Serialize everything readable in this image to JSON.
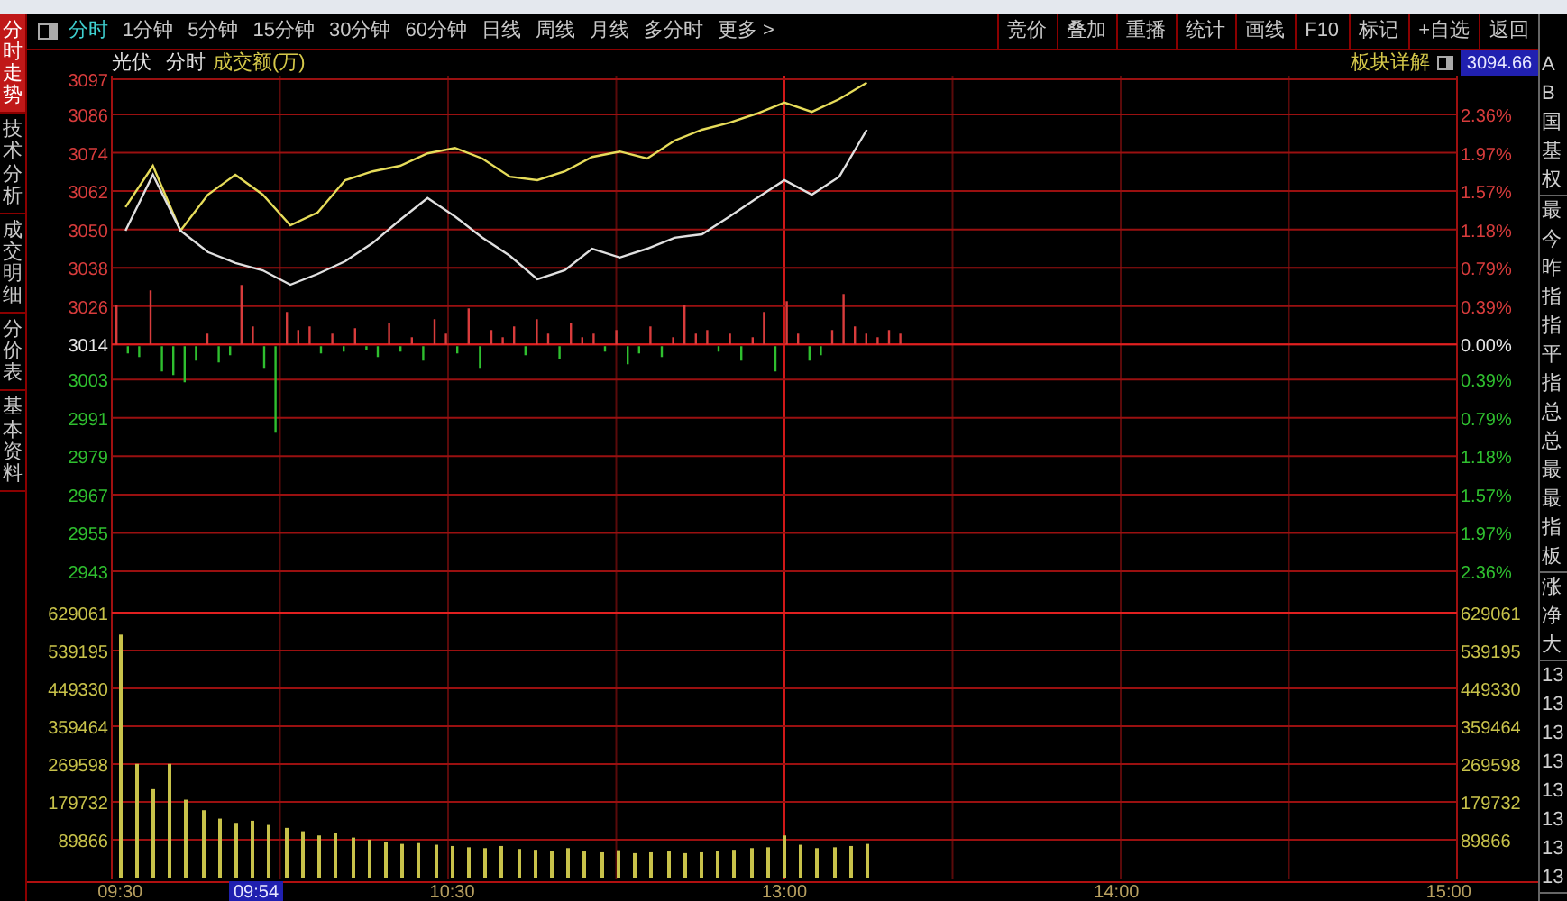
{
  "left_tabs": [
    {
      "label": "分时走势",
      "selected": true
    },
    {
      "label": "技术分析",
      "selected": false
    },
    {
      "label": "成交明细",
      "selected": false
    },
    {
      "label": "分价表",
      "selected": false
    },
    {
      "label": "基本资料",
      "selected": false
    }
  ],
  "period_tabs": [
    {
      "label": "分时",
      "selected": true
    },
    {
      "label": "1分钟",
      "selected": false
    },
    {
      "label": "5分钟",
      "selected": false
    },
    {
      "label": "15分钟",
      "selected": false
    },
    {
      "label": "30分钟",
      "selected": false
    },
    {
      "label": "60分钟",
      "selected": false
    },
    {
      "label": "日线",
      "selected": false
    },
    {
      "label": "周线",
      "selected": false
    },
    {
      "label": "月线",
      "selected": false
    },
    {
      "label": "多分时",
      "selected": false
    },
    {
      "label": "更多 >",
      "selected": false
    }
  ],
  "toolbar_buttons": [
    "竞价",
    "叠加",
    "重播",
    "统计",
    "画线",
    "F10",
    "标记",
    "+自选",
    "返回"
  ],
  "header": {
    "name": "光伏",
    "mode": "分时",
    "indicator": "成交额(万)",
    "detail_link": "板块详解"
  },
  "cursor": {
    "price": "3094.66",
    "time": "09:54"
  },
  "price_pane": {
    "chart_data": {
      "type": "line",
      "grid": true,
      "categories": [
        null,
        null,
        null,
        null,
        null,
        null,
        null,
        null,
        null,
        null,
        null,
        null,
        null,
        null,
        null,
        null,
        null,
        null,
        null,
        null,
        null,
        null,
        null,
        null,
        null,
        null,
        null,
        null,
        null,
        null,
        null,
        null,
        null,
        null,
        null,
        null,
        null,
        null,
        null,
        null,
        null,
        null,
        null,
        null,
        null,
        null,
        null,
        null,
        null
      ],
      "series": [
        {
          "color": "#e6dc5a",
          "values": [
            3057.0,
            3069.9,
            3049.6,
            3060.9,
            3067.1,
            3060.9,
            3051.3,
            3055.3,
            3065.4,
            3068.2,
            3069.9,
            3073.8,
            3075.5,
            3072.2,
            3066.5,
            3065.4,
            3068.2,
            3072.7,
            3074.4,
            3072.2,
            3077.8,
            3081.2,
            3083.4,
            3086.3,
            3089.7,
            3086.8,
            3090.8,
            3095.9,
            null,
            null,
            null,
            null,
            null,
            null,
            null,
            null,
            null,
            null,
            null,
            null,
            null,
            null,
            null,
            null,
            null,
            null,
            null,
            null,
            null
          ]
        },
        {
          "color": "#e0e0e0",
          "values": [
            3049.6,
            3067.1,
            3049.6,
            3042.9,
            3039.5,
            3037.2,
            3032.7,
            3036.1,
            3040.0,
            3045.7,
            3053.0,
            3059.8,
            3054.1,
            3047.4,
            3041.7,
            3034.4,
            3037.2,
            3044.0,
            3041.2,
            3044.0,
            3047.4,
            3048.5,
            3054.1,
            3059.8,
            3065.4,
            3060.9,
            3066.5,
            3081.2,
            null,
            null,
            null,
            null,
            null,
            null,
            null,
            null,
            null,
            null,
            null,
            null,
            null,
            null,
            null,
            null,
            null,
            null,
            null,
            null,
            null
          ]
        }
      ],
      "ylim": [
        2943,
        3097
      ],
      "yticks": [
        3097,
        3086,
        3074,
        3062,
        3050,
        3038,
        3026,
        3014,
        3003,
        2991,
        2979,
        2967,
        2955,
        2943
      ]
    },
    "percent_labels": [
      {
        "label": "2.36%",
        "kind": "up"
      },
      {
        "label": "1.97%",
        "kind": "up"
      },
      {
        "label": "1.57%",
        "kind": "up"
      },
      {
        "label": "1.18%",
        "kind": "up"
      },
      {
        "label": "0.79%",
        "kind": "up"
      },
      {
        "label": "0.39%",
        "kind": "up"
      },
      {
        "label": "0.00%",
        "kind": "flat"
      },
      {
        "label": "0.39%",
        "kind": "down"
      },
      {
        "label": "0.79%",
        "kind": "down"
      },
      {
        "label": "1.18%",
        "kind": "down"
      },
      {
        "label": "1.57%",
        "kind": "down"
      },
      {
        "label": "1.97%",
        "kind": "down"
      },
      {
        "label": "2.36%",
        "kind": "down"
      }
    ]
  },
  "volume_pane": {
    "chart_data": {
      "type": "bar",
      "grid": true,
      "categories": [
        "09:30",
        null,
        null,
        null,
        null,
        null,
        null,
        null,
        null,
        null,
        null,
        null,
        null,
        null,
        null,
        null,
        null,
        null,
        null,
        null,
        "10:30",
        null,
        null,
        null,
        null,
        null,
        null,
        null,
        null,
        null,
        null,
        null,
        null,
        null,
        null,
        null,
        null,
        null,
        null,
        null,
        "13:00",
        null,
        null,
        null,
        null,
        null,
        null,
        null,
        null,
        null,
        null,
        null,
        null,
        null,
        null,
        null,
        null,
        null,
        null,
        null,
        "14:00",
        null,
        null,
        null,
        null,
        null,
        null,
        null,
        null,
        null,
        null,
        null,
        null,
        null,
        null,
        null,
        null,
        null,
        null,
        null,
        "15:00"
      ],
      "values": [
        577000,
        270000,
        210000,
        270000,
        185000,
        160000,
        140000,
        130000,
        135000,
        125000,
        118000,
        110000,
        100000,
        105000,
        95000,
        90000,
        85000,
        80000,
        82000,
        78000,
        75000,
        72000,
        70000,
        75000,
        68000,
        66000,
        64000,
        70000,
        62000,
        60000,
        65000,
        58000,
        60000,
        62000,
        58000,
        60000,
        64000,
        66000,
        70000,
        72000,
        100000,
        78000,
        70000,
        72000,
        75000,
        80000,
        null,
        null,
        null,
        null,
        null,
        null,
        null,
        null,
        null,
        null,
        null,
        null,
        null,
        null,
        null,
        null,
        null,
        null,
        null,
        null,
        null,
        null,
        null,
        null,
        null,
        null,
        null,
        null,
        null,
        null,
        null,
        null,
        null,
        null,
        null
      ],
      "ylim": [
        0,
        629061
      ],
      "yticks": [
        629061,
        539195,
        449330,
        359464,
        269598,
        179732,
        89866
      ]
    },
    "right_labels": [
      "629061",
      "539195",
      "449330",
      "359464",
      "269598",
      "179732",
      "89866"
    ]
  },
  "side_panel": [
    [
      "A",
      "B",
      "国",
      "基",
      "权"
    ],
    [
      "最",
      "今",
      "昨",
      "指",
      "指",
      "平",
      "指",
      "总",
      "总",
      "最",
      "最",
      "指",
      "板"
    ],
    [
      "涨",
      "净",
      "大"
    ],
    [
      "13",
      "13",
      "13",
      "13",
      "13",
      "13",
      "13",
      "13"
    ]
  ]
}
